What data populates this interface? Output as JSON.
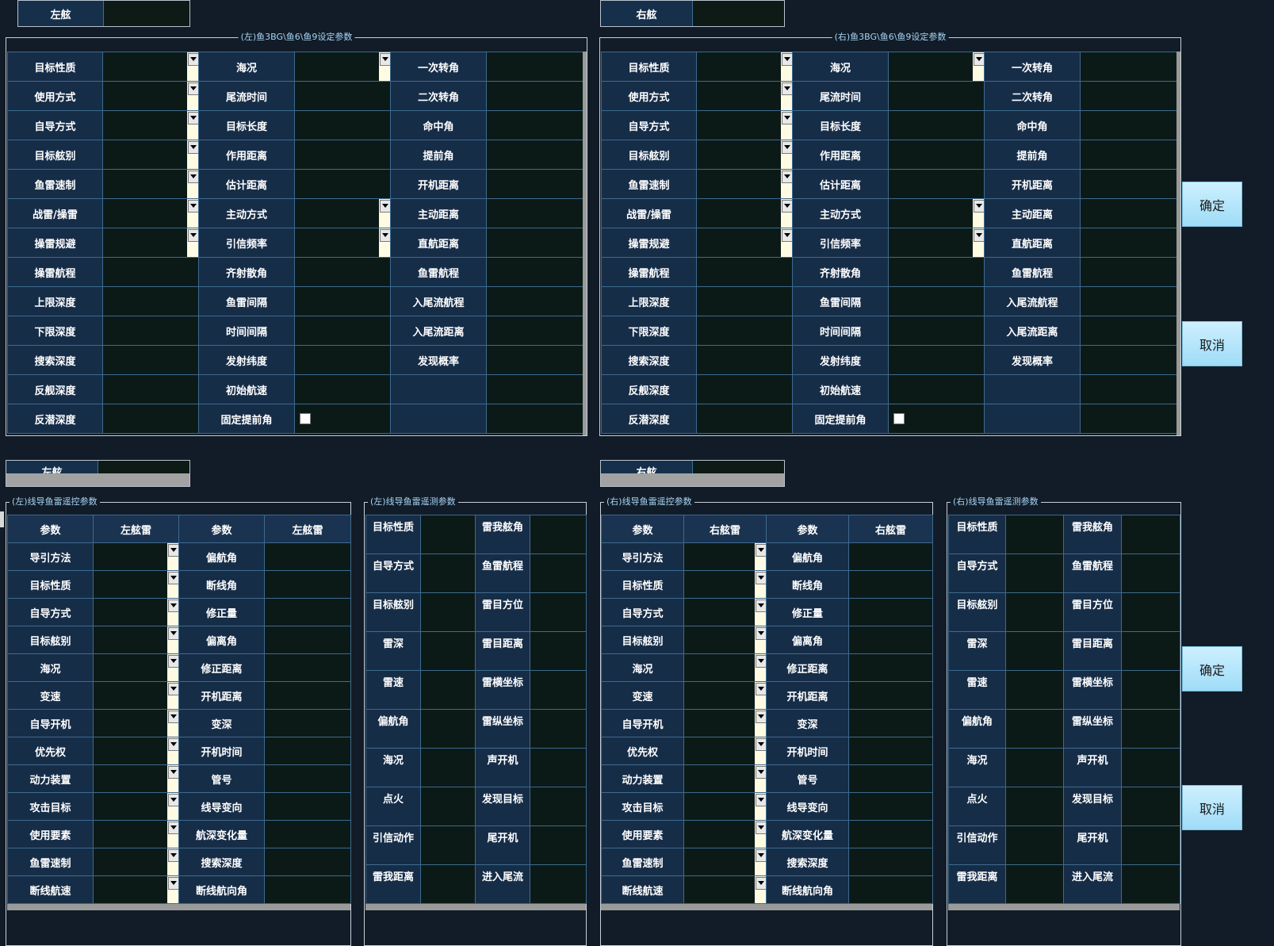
{
  "top": {
    "left_side": {
      "label": "左舷"
    },
    "right_side": {
      "label": "右舷"
    },
    "left_title": "(左)鱼3BG\\鱼6\\鱼9设定参数",
    "right_title": "(右)鱼3BG\\鱼6\\鱼9设定参数",
    "col1": [
      "目标性质",
      "使用方式",
      "自导方式",
      "目标舷别",
      "鱼雷速制",
      "战雷/操雷",
      "操雷规避",
      "操雷航程",
      "上限深度",
      "下限深度",
      "搜索深度",
      "反舰深度",
      "反潜深度"
    ],
    "col2": [
      "海况",
      "尾流时间",
      "目标长度",
      "作用距离",
      "估计距离",
      "主动方式",
      "引信频率",
      "齐射散角",
      "鱼雷间隔",
      "时间间隔",
      "发射纬度",
      "初始航速",
      "固定提前角"
    ],
    "col3": [
      "一次转角",
      "二次转角",
      "命中角",
      "提前角",
      "开机距离",
      "主动距离",
      "直航距离",
      "鱼雷航程",
      "入尾流航程",
      "入尾流距离",
      "发现概率",
      "",
      ""
    ],
    "confirm": "确定",
    "cancel": "取消"
  },
  "bottom": {
    "left_side": {
      "label": "左舷"
    },
    "right_side": {
      "label": "右舷"
    },
    "left_remote_title": "(左)线导鱼雷遥控参数",
    "left_telemetry_title": "(左)线导鱼雷遥测参数",
    "right_remote_title": "(右)线导鱼雷遥控参数",
    "right_telemetry_title": "(右)线导鱼雷遥测参数",
    "remote_headers_left": [
      "参数",
      "左舷雷",
      "参数",
      "左舷雷"
    ],
    "remote_headers_right": [
      "参数",
      "右舷雷",
      "参数",
      "右舷雷"
    ],
    "remote_col1": [
      "导引方法",
      "目标性质",
      "自导方式",
      "目标舷别",
      "海况",
      "变速",
      "自导开机",
      "优先权",
      "动力装置",
      "攻击目标",
      "使用要素",
      "鱼雷速制",
      "断线航速"
    ],
    "remote_col2": [
      "偏航角",
      "断线角",
      "修正量",
      "偏离角",
      "修正距离",
      "开机距离",
      "变深",
      "开机时间",
      "管号",
      "线导变向",
      "航深变化量",
      "搜索深度",
      "断线航向角"
    ],
    "telemetry_col1": [
      "目标性质",
      "自导方式",
      "目标舷别",
      "雷深",
      "雷速",
      "偏航角",
      "海况",
      "点火",
      "引信动作",
      "雷我距离"
    ],
    "telemetry_col2": [
      "雷我舷角",
      "鱼雷航程",
      "雷目方位",
      "雷目距离",
      "雷横坐标",
      "雷纵坐标",
      "声开机",
      "发现目标",
      "尾开机",
      "进入尾流"
    ],
    "confirm": "确定",
    "cancel": "取消"
  }
}
